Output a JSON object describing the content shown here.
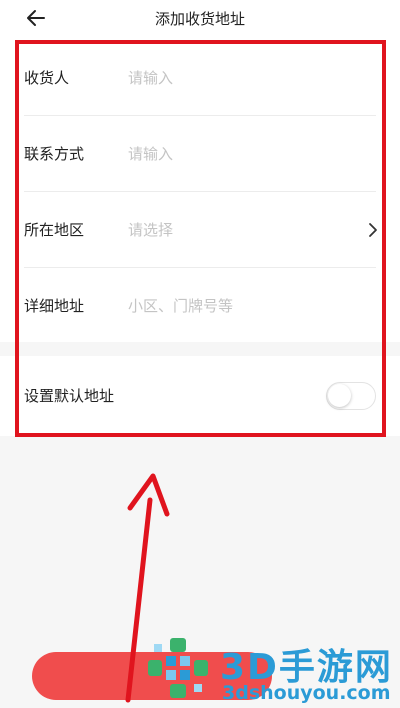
{
  "header": {
    "title": "添加收货地址",
    "back_icon": "arrow-left-icon"
  },
  "form": {
    "fields": [
      {
        "label": "收货人",
        "placeholder": "请输入",
        "value": ""
      },
      {
        "label": "联系方式",
        "placeholder": "请输入",
        "value": ""
      },
      {
        "label": "所在地区",
        "placeholder": "请选择",
        "value": "",
        "trailing_icon": "chevron-right-icon"
      },
      {
        "label": "详细地址",
        "placeholder": "小区、门牌号等",
        "value": ""
      }
    ],
    "default_address": {
      "label": "设置默认地址",
      "enabled": false
    }
  },
  "annotation": {
    "highlight_color": "#e0141e"
  },
  "save_button": {
    "color": "#f04d4d"
  },
  "watermark": {
    "brand": "3D手游网",
    "url": "3dshouyou.com",
    "color": "#2b9bd6"
  }
}
